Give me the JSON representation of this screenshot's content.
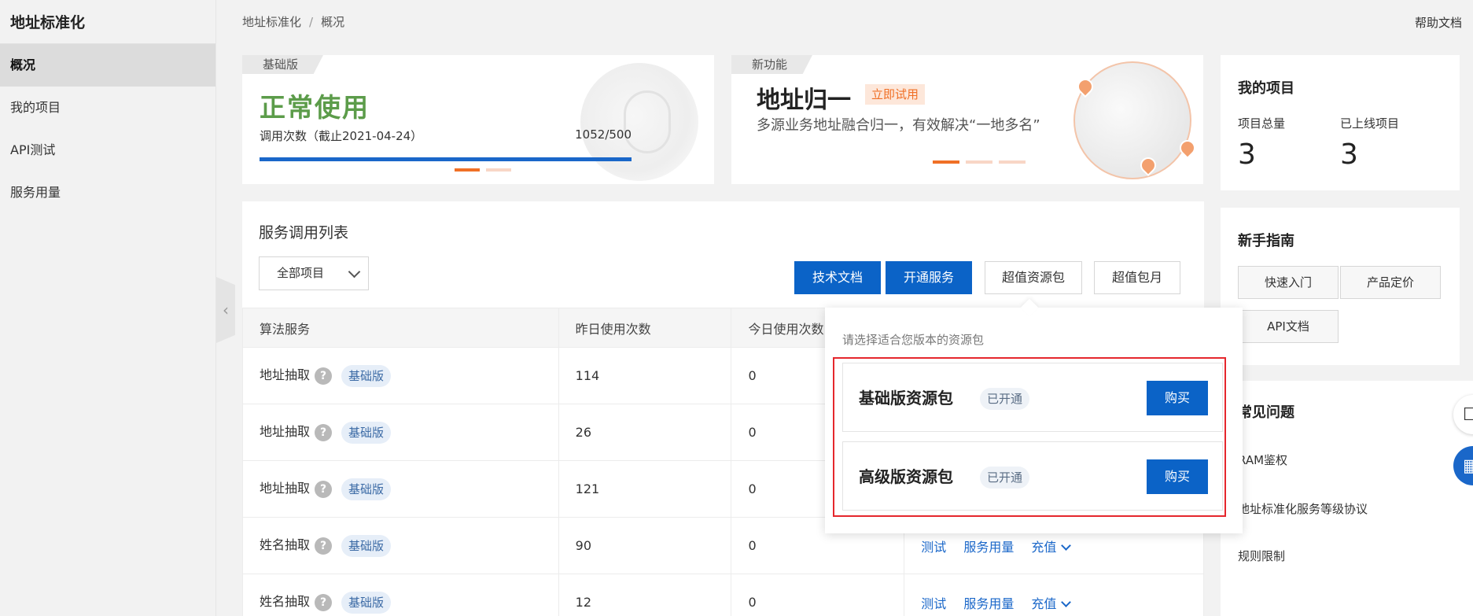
{
  "sidebar": {
    "title": "地址标准化",
    "items": [
      {
        "label": "概况"
      },
      {
        "label": "我的项目"
      },
      {
        "label": "API测试"
      },
      {
        "label": "服务用量"
      }
    ]
  },
  "header": {
    "breadcrumb": [
      "地址标准化",
      "/",
      "概况"
    ],
    "help": "帮助文档"
  },
  "banner_basic": {
    "tag": "基础版",
    "status": "正常使用",
    "call_label": "调用次数（截止2021-04-24）",
    "call_count": "1052/500",
    "progress": 1.0
  },
  "banner_new": {
    "tag": "新功能",
    "headline": "地址归一",
    "try": "立即试用",
    "desc": "多源业务地址融合归一，有效解决“一地多名”"
  },
  "projects": {
    "title": "我的项目",
    "total_label": "项目总量",
    "total": "3",
    "online_label": "已上线项目",
    "online": "3"
  },
  "guide": {
    "title": "新手指南",
    "buttons": [
      "快速入门",
      "产品定价",
      "API文档"
    ]
  },
  "faq": {
    "title": "常见问题",
    "items": [
      "RAM鉴权",
      "地址标准化服务等级协议",
      "规则限制"
    ]
  },
  "service_list": {
    "title": "服务调用列表",
    "filter": "全部项目",
    "buttons": {
      "docs": "技术文档",
      "open": "开通服务",
      "pack": "超值资源包",
      "monthly": "超值包月"
    },
    "columns": [
      "算法服务",
      "昨日使用次数",
      "今日使用次数",
      ""
    ],
    "rows": [
      {
        "name": "地址抽取",
        "version": "基础版",
        "yesterday": "114",
        "today": "0"
      },
      {
        "name": "地址抽取",
        "version": "基础版",
        "yesterday": "26",
        "today": "0"
      },
      {
        "name": "地址抽取",
        "version": "基础版",
        "yesterday": "121",
        "today": "0"
      },
      {
        "name": "姓名抽取",
        "version": "基础版",
        "yesterday": "90",
        "today": "0"
      },
      {
        "name": "姓名抽取",
        "version": "基础版",
        "yesterday": "12",
        "today": "0"
      }
    ],
    "actions": {
      "test": "测试",
      "usage": "服务用量",
      "recharge": "充值"
    },
    "help_mark": "?"
  },
  "popover": {
    "hint": "请选择适合您版本的资源包",
    "packages": [
      {
        "name": "基础版资源包",
        "status": "已开通",
        "buy": "购买"
      },
      {
        "name": "高级版资源包",
        "status": "已开通",
        "buy": "购买"
      }
    ]
  },
  "colors": {
    "primary": "#0b63c7",
    "accent": "#f07026",
    "success": "#5c9c4a",
    "highlight": "#e5272d"
  }
}
